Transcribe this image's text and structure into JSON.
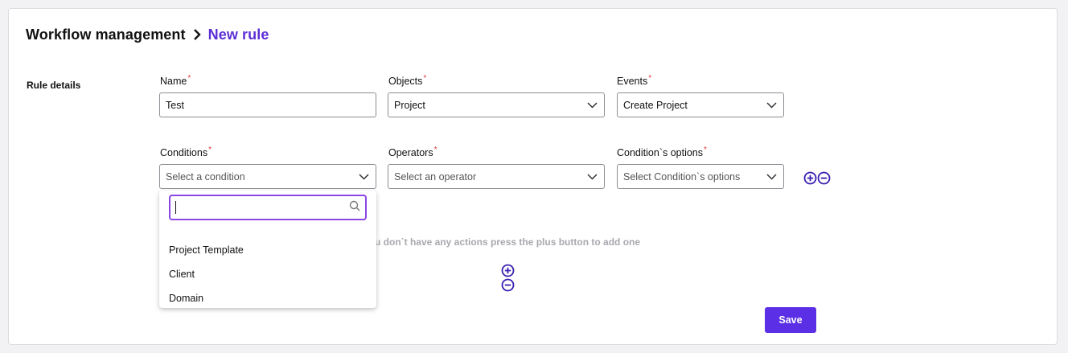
{
  "breadcrumb": {
    "root": "Workflow management",
    "current": "New rule"
  },
  "section": {
    "label": "Rule details"
  },
  "fields": {
    "name": {
      "label": "Name",
      "required_mark": "*",
      "value": "Test"
    },
    "objects": {
      "label": "Objects",
      "required_mark": "*",
      "value": "Project"
    },
    "events": {
      "label": "Events",
      "required_mark": "*",
      "value": "Create Project"
    },
    "conditions": {
      "label": "Conditions",
      "required_mark": "*",
      "placeholder": "Select a condition"
    },
    "operators": {
      "label": "Operators",
      "required_mark": "*",
      "placeholder": "Select an operator"
    },
    "condition_options": {
      "label": "Condition`s options",
      "required_mark": "*",
      "placeholder": "Select Condition`s options"
    }
  },
  "dropdown": {
    "search_value": "",
    "items": [
      "Project Template",
      "Client",
      "Domain"
    ]
  },
  "actions": {
    "hint": "u don`t have any actions press the plus button to add one"
  },
  "buttons": {
    "save": "Save"
  },
  "colors": {
    "accent": "#5b2fe6",
    "required": "#e23a3a",
    "focus": "#8b46e6"
  },
  "icons": [
    "chevron-right-icon",
    "chevron-down-icon",
    "search-icon",
    "plus-circle-icon",
    "minus-circle-icon"
  ]
}
